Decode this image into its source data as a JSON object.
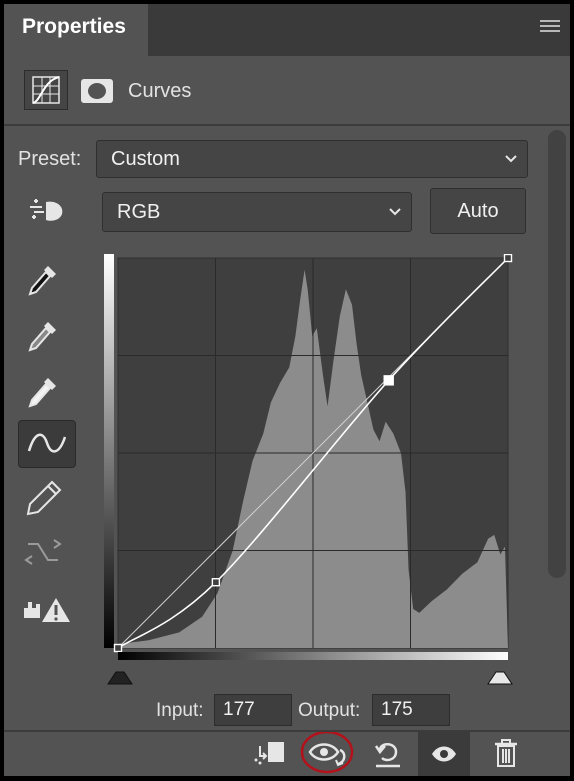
{
  "panel": {
    "tab_title": "Properties"
  },
  "adjustment": {
    "title": "Curves"
  },
  "preset": {
    "label": "Preset:",
    "value": "Custom"
  },
  "channel": {
    "value": "RGB"
  },
  "auto_button": {
    "label": "Auto"
  },
  "curve": {
    "points": [
      [
        0,
        0
      ],
      [
        64,
        43
      ],
      [
        177,
        175
      ],
      [
        255,
        255
      ]
    ],
    "selected_point": [
      177,
      175
    ]
  },
  "io": {
    "input_label": "Input:",
    "input_value": "177",
    "output_label": "Output:",
    "output_value": "175"
  },
  "colors": {
    "panel_bg": "#535353",
    "graph_bg": "#3f3f3f",
    "histogram": "#8c8c8c",
    "highlight_ring": "#b3121b"
  },
  "tools": [
    "sample-black-point",
    "sample-gray-point",
    "sample-white-point",
    "edit-points",
    "draw-curve",
    "smooth-curve",
    "clipping-warning"
  ],
  "bottom_icons": [
    "clip-to-layer",
    "view-previous-state",
    "reset",
    "toggle-visibility",
    "delete"
  ]
}
